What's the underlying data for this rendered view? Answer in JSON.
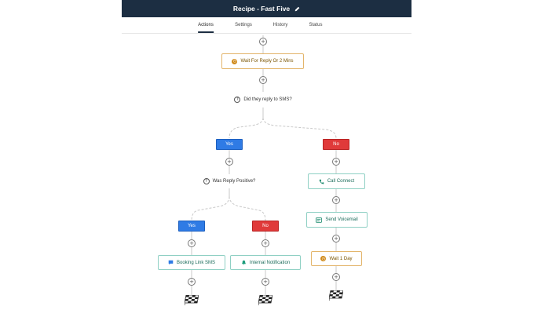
{
  "header": {
    "title": "Recipe - Fast Five",
    "edit_icon": "pencil-icon"
  },
  "tabs": [
    {
      "label": "Actions",
      "active": true
    },
    {
      "label": "Settings",
      "active": false
    },
    {
      "label": "History",
      "active": false
    },
    {
      "label": "Status",
      "active": false
    }
  ],
  "flow": {
    "wait_reply": {
      "label": "Wait For Reply Or 2 Mins",
      "icon": "clock-icon"
    },
    "condition_sms": {
      "label": "Did they reply to SMS?",
      "icon": "question-icon"
    },
    "branch1": {
      "yes": "Yes",
      "no": "No"
    },
    "condition_positive": {
      "label": "Was Reply Positive?",
      "icon": "question-icon"
    },
    "branch2": {
      "yes": "Yes",
      "no": "No"
    },
    "booking_sms": {
      "label": "Booking Link SMS",
      "icon": "message-icon"
    },
    "internal_notification": {
      "label": "Internal Notification",
      "icon": "bell-icon"
    },
    "call_connect": {
      "label": "Call Connect",
      "icon": "phone-icon"
    },
    "send_voicemail": {
      "label": "Send Voicemail",
      "icon": "voicemail-icon"
    },
    "wait_day": {
      "label": "Wait 1 Day",
      "icon": "clock-icon"
    },
    "end_icon": "checkered-flag-icon"
  },
  "colors": {
    "header_bg": "#1c2e42",
    "yes": "#2f7be5",
    "no": "#e03a3a",
    "wait_border": "#e3b56b",
    "action_border": "#8fd0c4"
  }
}
